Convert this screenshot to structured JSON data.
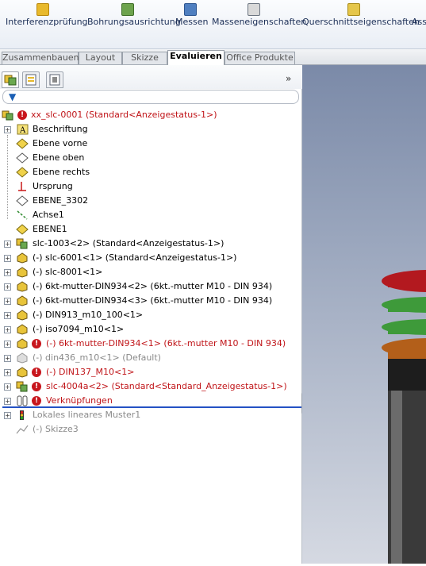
{
  "toolbar": {
    "buttons": [
      {
        "label": "Interferenzprüfung",
        "icon": "interference-check-icon"
      },
      {
        "label": "Bohrungsausrichtung",
        "icon": "hole-alignment-icon"
      },
      {
        "label": "Messen",
        "icon": "measure-icon"
      },
      {
        "label": "Masseneigenschaften",
        "icon": "mass-properties-icon"
      },
      {
        "label": "Querschnittseigenschaften",
        "icon": "section-properties-icon"
      },
      {
        "label": "Ass",
        "icon": "assembly-icon"
      }
    ]
  },
  "tabs": [
    {
      "label": "Zusammenbauen"
    },
    {
      "label": "Layout"
    },
    {
      "label": "Skizze"
    },
    {
      "label": "Evaluieren",
      "active": true
    },
    {
      "label": "Office Produkte"
    }
  ],
  "panel": {
    "expand_glyph": "»",
    "filter_icon": "filter-icon"
  },
  "tree": {
    "root": "xx_slc-0001  (Standard<Anzeigestatus-1>)",
    "items": [
      {
        "label": "Beschriftung",
        "icon": "annotation-icon",
        "expandable": true
      },
      {
        "label": "Ebene vorne",
        "icon": "plane-icon"
      },
      {
        "label": "Ebene oben",
        "icon": "plane-icon"
      },
      {
        "label": "Ebene rechts",
        "icon": "plane-icon"
      },
      {
        "label": "Ursprung",
        "icon": "origin-icon"
      },
      {
        "label": "EBENE_3302",
        "icon": "plane-icon"
      },
      {
        "label": "Achse1",
        "icon": "axis-icon"
      },
      {
        "label": "EBENE1",
        "icon": "plane-icon"
      },
      {
        "label": "slc-1003<2> (Standard<Anzeigestatus-1>)",
        "icon": "component-icon",
        "expandable": true
      },
      {
        "label": "(-) slc-6001<1> (Standard<Anzeigestatus-1>)",
        "icon": "part-icon",
        "expandable": true
      },
      {
        "label": "(-) slc-8001<1>",
        "icon": "part-icon",
        "expandable": true
      },
      {
        "label": "(-) 6kt-mutter-DIN934<2> (6kt.-mutter M10 - DIN 934)",
        "icon": "part-icon",
        "expandable": true
      },
      {
        "label": "(-) 6kt-mutter-DIN934<3> (6kt.-mutter M10 - DIN 934)",
        "icon": "part-icon",
        "expandable": true
      },
      {
        "label": "(-) DIN913_m10_100<1>",
        "icon": "part-icon",
        "expandable": true
      },
      {
        "label": "(-) iso7094_m10<1>",
        "icon": "part-icon",
        "expandable": true
      },
      {
        "label": "(-) 6kt-mutter-DIN934<1> (6kt.-mutter M10 - DIN 934)",
        "icon": "part-icon",
        "expandable": true,
        "error": true
      },
      {
        "label": "(-) din436_m10<1> (Default)",
        "icon": "part-icon",
        "expandable": true,
        "suppressed": true
      },
      {
        "label": "(-) DIN137_M10<1>",
        "icon": "part-icon",
        "expandable": true,
        "error": true
      },
      {
        "label": "slc-4004a<2> (Standard<Standard_Anzeigestatus-1>)",
        "icon": "component-icon",
        "expandable": true,
        "error": true
      },
      {
        "label": "Verknüpfungen",
        "icon": "mates-icon",
        "expandable": true,
        "error": true
      },
      {
        "label": "Lokales lineares Muster1",
        "icon": "pattern-icon",
        "expandable": true,
        "suppressed": true
      },
      {
        "label": "(-) Skizze3",
        "icon": "sketch-icon",
        "suppressed": true
      }
    ]
  },
  "colors": {
    "error": "#c01418",
    "suppressed": "#8a8a8a",
    "rollback_bar": "#2452c4",
    "viewport_top": "#7b8aa8"
  }
}
